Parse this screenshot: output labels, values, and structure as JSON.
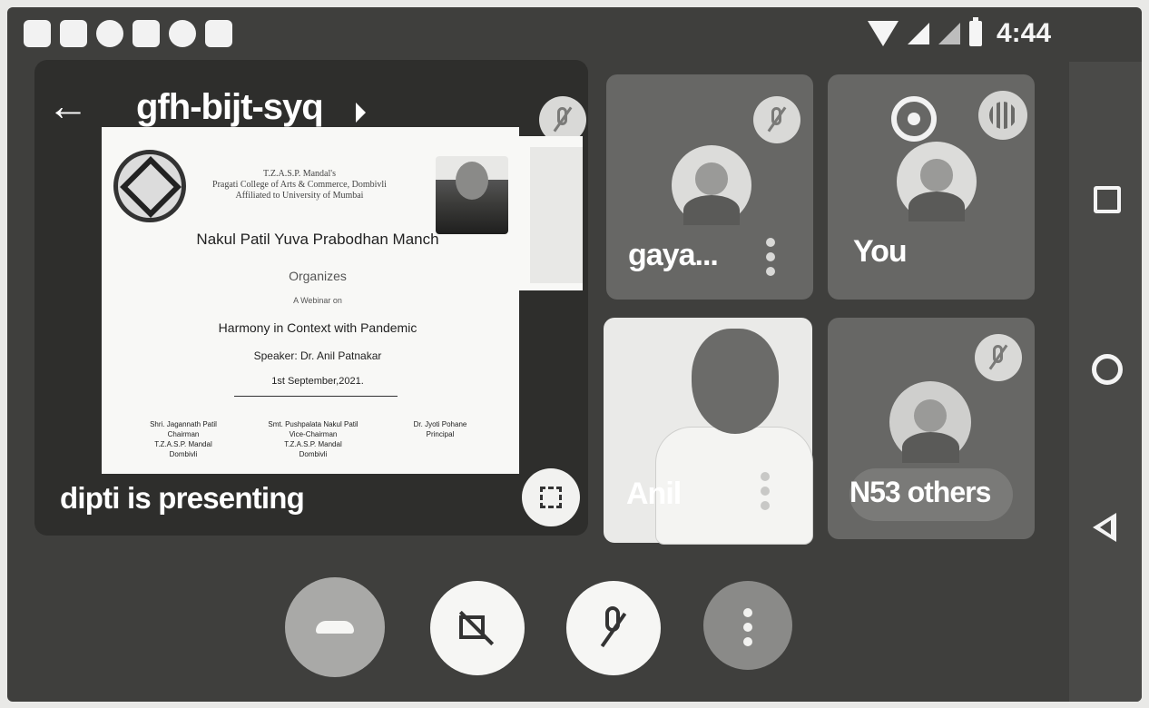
{
  "status_bar": {
    "time": "4:44",
    "notification_icons": [
      "video-camera-icon",
      "news-icon",
      "whatsapp-icon",
      "contacts-icon",
      "heart-check-icon",
      "image-icon"
    ],
    "system_icons": [
      "wifi-icon",
      "signal-icon",
      "signal-outline-icon",
      "battery-icon"
    ]
  },
  "presentation": {
    "meeting_code": "gfh-bijt-syq",
    "presenter_label": "dipti is presenting",
    "slide": {
      "institution": "T.Z.A.S.P. Mandal's\nPragati College of Arts & Commerce, Dombivli\nAffiliated to University of Mumbai",
      "title": "Nakul Patil Yuva Prabodhan Manch",
      "organizes": "Organizes",
      "webinar": "A Webinar on",
      "topic": "Harmony in Context with Pandemic",
      "speaker": "Speaker: Dr. Anil Patnakar",
      "date": "1st September,2021.",
      "signatories": [
        "Shri. Jagannath Patil\nChairman\nT.Z.A.S.P. Mandal\nDombivli",
        "Smt. Pushpalata Nakul Patil\nVice-Chairman\nT.Z.A.S.P. Mandal\nDombivli",
        "Dr. Jyoti Pohane\nPrincipal"
      ]
    }
  },
  "participants": {
    "gaya": {
      "name": "gaya..."
    },
    "you": {
      "name": "You"
    },
    "anil": {
      "name": "Anil"
    },
    "others": {
      "name": "N53 others"
    }
  },
  "controls": [
    "end-call",
    "camera-off",
    "mic-off",
    "more-options"
  ]
}
